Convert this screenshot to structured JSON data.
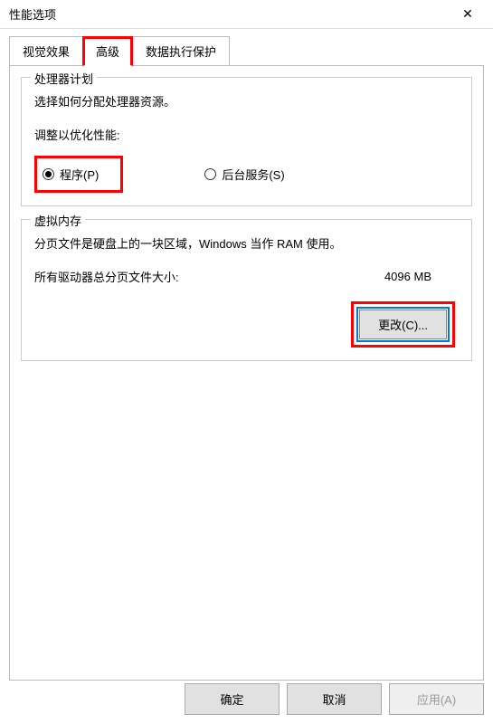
{
  "window": {
    "title": "性能选项",
    "close": "✕"
  },
  "tabs": {
    "visual": "视觉效果",
    "advanced": "高级",
    "dep": "数据执行保护"
  },
  "processor": {
    "title": "处理器计划",
    "description": "选择如何分配处理器资源。",
    "optimize_label": "调整以优化性能:",
    "programs": "程序(P)",
    "background": "后台服务(S)"
  },
  "virtual_memory": {
    "title": "虚拟内存",
    "description": "分页文件是硬盘上的一块区域，Windows 当作 RAM 使用。",
    "total_label": "所有驱动器总分页文件大小:",
    "total_value": "4096 MB",
    "change_button": "更改(C)..."
  },
  "buttons": {
    "ok": "确定",
    "cancel": "取消",
    "apply": "应用(A)"
  }
}
